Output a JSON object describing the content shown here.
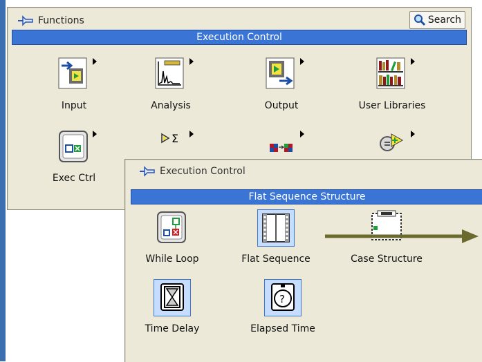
{
  "functions_palette": {
    "title": "Functions",
    "search_label": "Search",
    "category": "Execution Control",
    "items": [
      {
        "label": "Input",
        "icon": "input-icon"
      },
      {
        "label": "Analysis",
        "icon": "analysis-icon"
      },
      {
        "label": "Output",
        "icon": "output-icon"
      },
      {
        "label": "User Libraries",
        "icon": "user-libraries-icon"
      },
      {
        "label": "Exec Ctrl",
        "icon": "exec-ctrl-icon"
      },
      {
        "label": "",
        "icon": "math-icon"
      },
      {
        "label": "",
        "icon": "signal-icon"
      },
      {
        "label": "",
        "icon": "express-icon"
      }
    ]
  },
  "exec_palette": {
    "title": "Execution Control",
    "category": "Flat Sequence Structure",
    "items": [
      {
        "label": "While Loop",
        "icon": "while-loop-icon"
      },
      {
        "label": "Flat Sequence",
        "icon": "flat-sequence-icon",
        "selected": true
      },
      {
        "label": "Case Structure",
        "icon": "case-structure-icon"
      },
      {
        "label": "Time Delay",
        "icon": "time-delay-icon",
        "selected": true
      },
      {
        "label": "Elapsed Time",
        "icon": "elapsed-time-icon",
        "selected": true
      }
    ]
  },
  "colors": {
    "palette_bg": "#ede9d8",
    "category_bar": "#3a75d6",
    "selection": "#c6ddff",
    "arrow": "#6b6a2e"
  }
}
